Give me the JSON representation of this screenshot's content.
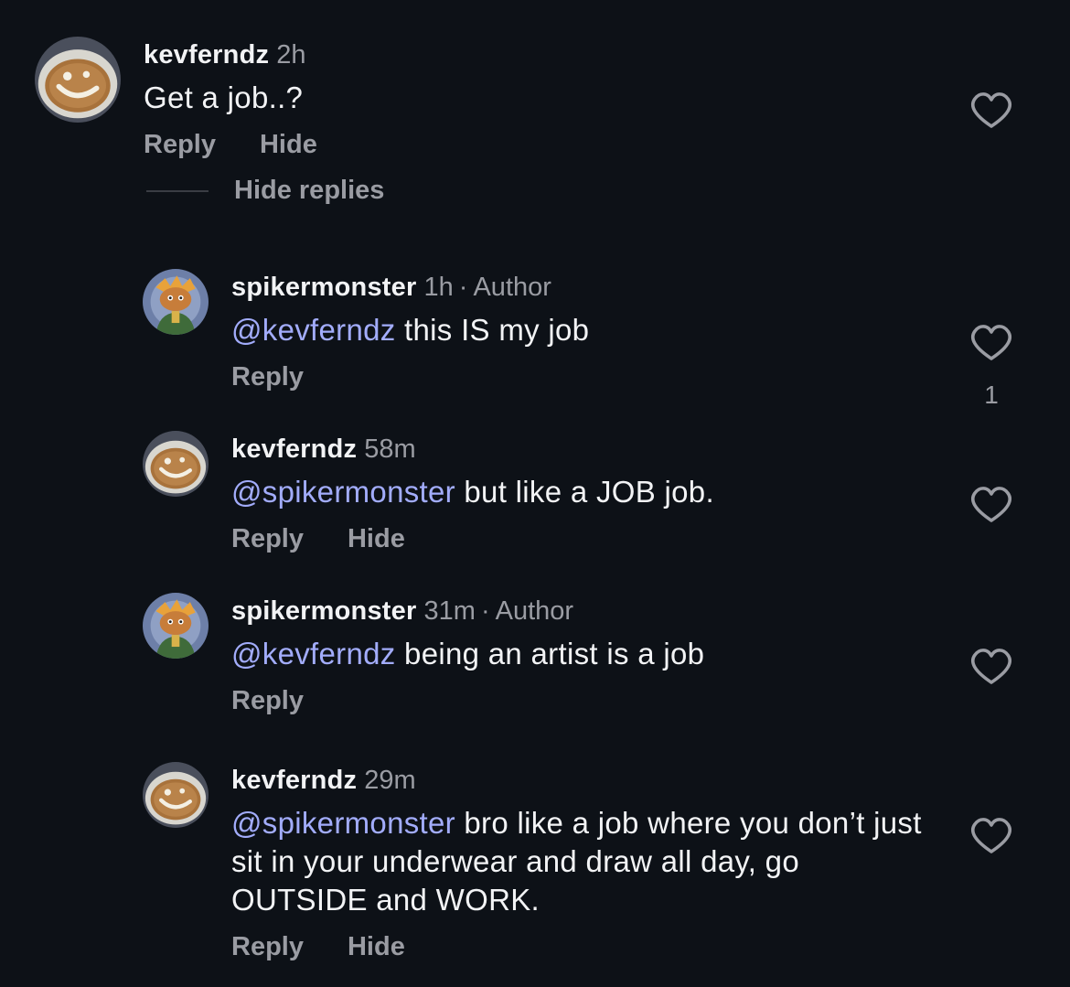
{
  "comments": [
    {
      "username": "kevferndz",
      "time": "2h",
      "author_tag": "",
      "mention": "",
      "text": "Get a job..?",
      "actions": [
        "Reply",
        "Hide"
      ],
      "like_count": "",
      "avatar": "smiley-avatar"
    },
    {
      "username": "spikermonster",
      "time": "1h",
      "author_tag": "Author",
      "mention": "@kevferndz",
      "text": "this IS my job",
      "actions": [
        "Reply"
      ],
      "like_count": "1",
      "avatar": "character-avatar"
    },
    {
      "username": "kevferndz",
      "time": "58m",
      "author_tag": "",
      "mention": "@spikermonster",
      "text": "but like a JOB job.",
      "actions": [
        "Reply",
        "Hide"
      ],
      "like_count": "",
      "avatar": "smiley-avatar"
    },
    {
      "username": "spikermonster",
      "time": "31m",
      "author_tag": "Author",
      "mention": "@kevferndz",
      "text": "being an artist is a job",
      "actions": [
        "Reply"
      ],
      "like_count": "",
      "avatar": "character-avatar"
    },
    {
      "username": "kevferndz",
      "time": "29m",
      "author_tag": "",
      "mention": "@spikermonster",
      "text": "bro like a job where you don’t just sit in your underwear and draw all day, go OUTSIDE and WORK.",
      "actions": [
        "Reply",
        "Hide"
      ],
      "like_count": "",
      "avatar": "smiley-avatar"
    }
  ],
  "hide_replies_label": "Hide replies",
  "colors": {
    "background": "#0d1117",
    "text": "#f2f3f5",
    "secondary": "#9a9ca3",
    "mention": "#a2acfb"
  }
}
